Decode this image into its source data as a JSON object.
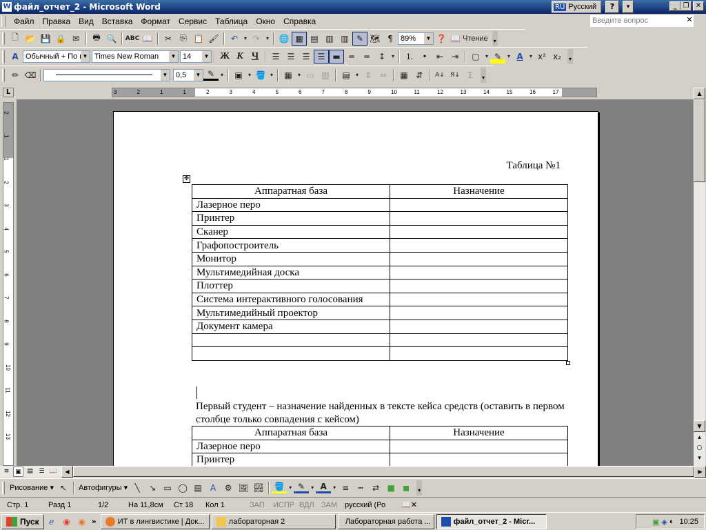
{
  "window": {
    "title": "файл_отчет_2 - Microsoft Word",
    "lang_code": "RU",
    "lang_name": "Русский",
    "help": "?"
  },
  "menu": {
    "items": [
      "Файл",
      "Правка",
      "Вид",
      "Вставка",
      "Формат",
      "Сервис",
      "Таблица",
      "Окно",
      "Справка"
    ],
    "ask_placeholder": "Введите вопрос"
  },
  "standard_toolbar": {
    "zoom": "89%",
    "reading_label": "Чтение"
  },
  "formatting_toolbar": {
    "style": "Обычный + По ц",
    "font": "Times New Roman",
    "size": "14",
    "bold": "Ж",
    "italic": "К",
    "underline": "Ч"
  },
  "tables_toolbar": {
    "line_weight": "0,5"
  },
  "ruler": {
    "ticks": [
      "3",
      "2",
      "1",
      "1",
      "2",
      "3",
      "4",
      "5",
      "6",
      "7",
      "8",
      "9",
      "10",
      "11",
      "12",
      "13",
      "14",
      "15",
      "16",
      "17"
    ],
    "vticks": [
      "2",
      "1",
      "1",
      "2",
      "3",
      "4",
      "5",
      "6",
      "7",
      "8",
      "9",
      "10",
      "11",
      "12",
      "13"
    ]
  },
  "document": {
    "caption": "Таблица №1",
    "table1": {
      "headers": [
        "Аппаратная база",
        "Назначение"
      ],
      "rows": [
        "Лазерное перо",
        "Принтер",
        "Сканер",
        "Графопостроитель",
        "Монитор",
        "Мультимедийная доска",
        "Плоттер",
        "Система интерактивного голосования",
        "Мультимедийный проектор",
        "Документ камера",
        "",
        ""
      ]
    },
    "paragraph": "Первый студент – назначение найденных в тексте кейса средств (оставить в первом столбце только совпадения с кейсом)",
    "table2": {
      "headers": [
        "Аппаратная база",
        "Назначение"
      ],
      "rows": [
        "Лазерное перо",
        "Принтер"
      ]
    }
  },
  "drawing_toolbar": {
    "draw_label": "Рисование",
    "autoshapes_label": "Автофигуры"
  },
  "status": {
    "page": "Стр. 1",
    "section": "Разд 1",
    "pages": "1/2",
    "at": "На 11,8см",
    "line": "Ст 18",
    "col": "Кол 1",
    "rec": "ЗАП",
    "trk": "ИСПР",
    "ext": "ВДЛ",
    "ovr": "ЗАМ",
    "language": "русский (Ро"
  },
  "taskbar": {
    "start": "Пуск",
    "tasks": [
      "ИТ в лингвистике | Док...",
      "лабораторная 2",
      "Лабораторная работа ...",
      "файл_отчет_2 - Micr..."
    ],
    "clock": "10:25"
  },
  "colors": {
    "titlebar": "#0a246a",
    "chrome": "#d4d0c8",
    "workspace": "#808080"
  }
}
